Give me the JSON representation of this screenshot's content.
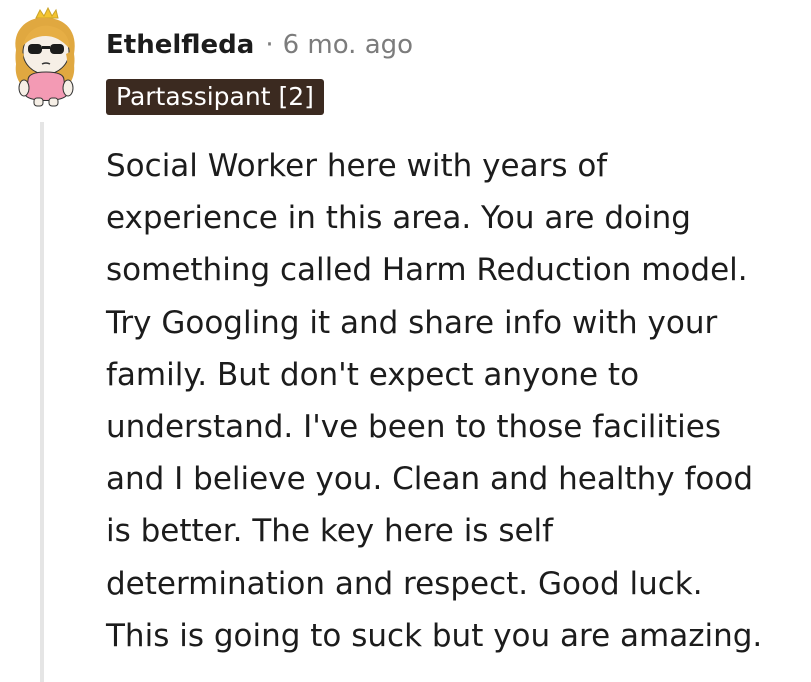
{
  "comment": {
    "author": "Ethelfleda",
    "separator": "·",
    "time_ago": "6 mo. ago",
    "flair": "Partassipant [2]",
    "body_lines": [
      "Social Worker here with years of",
      "experience in this area. You are doing",
      "something called Harm Reduction model.",
      "Try Googling it and share info with your",
      "family. But don't expect anyone to",
      "understand. I've been to those facilities",
      "and I believe you. Clean and healthy food",
      "is better. The key here is self",
      "determination and respect. Good luck.",
      "This is going to suck but you are amazing."
    ]
  },
  "colors": {
    "flair_background": "#3b2a20",
    "meta_text": "#7c7c7c",
    "thread_line": "#e5e5e5"
  },
  "icons": {
    "avatar": "snoo-avatar-with-sunglasses"
  }
}
